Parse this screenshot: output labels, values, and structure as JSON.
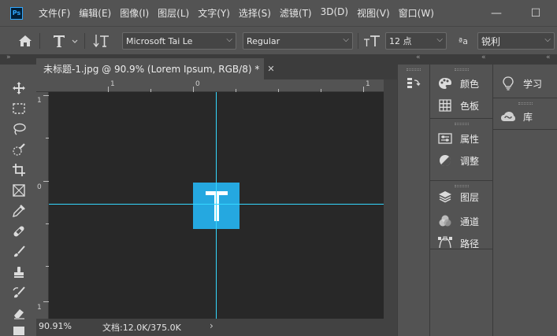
{
  "app": {
    "logo_text": "Ps"
  },
  "menu": [
    "文件(F)",
    "编辑(E)",
    "图像(I)",
    "图层(L)",
    "文字(Y)",
    "选择(S)",
    "滤镜(T)",
    "3D(D)",
    "视图(V)",
    "窗口(W)"
  ],
  "window_controls": {
    "minimize": "—",
    "restore": "☐"
  },
  "options_bar": {
    "font_family": "Microsoft Tai Le",
    "font_style": "Regular",
    "font_size": "12 点",
    "antialias_prefix": "ªa",
    "antialias": "锐利"
  },
  "document": {
    "tab_title": "未标题-1.jpg @ 90.9% (Lorem Ipsum, RGB/8) *",
    "close_glyph": "✕",
    "image_letter": "T"
  },
  "rulers": {
    "h_labels": [
      "1",
      "0",
      "1"
    ],
    "v_labels": [
      "1",
      "0",
      "1"
    ]
  },
  "status": {
    "zoom": "90.91%",
    "doc_info": "文档:12.0K/375.0K",
    "arrow": "›"
  },
  "panels": {
    "col1": [
      "颜色",
      "色板",
      "属性",
      "调整",
      "图层",
      "通道",
      "路径"
    ],
    "col2": [
      "学习",
      "库"
    ]
  },
  "colors": {
    "ui_bg": "#535353",
    "canvas": "#282828",
    "guide": "#35d7ff",
    "accent": "#25a8e0"
  }
}
